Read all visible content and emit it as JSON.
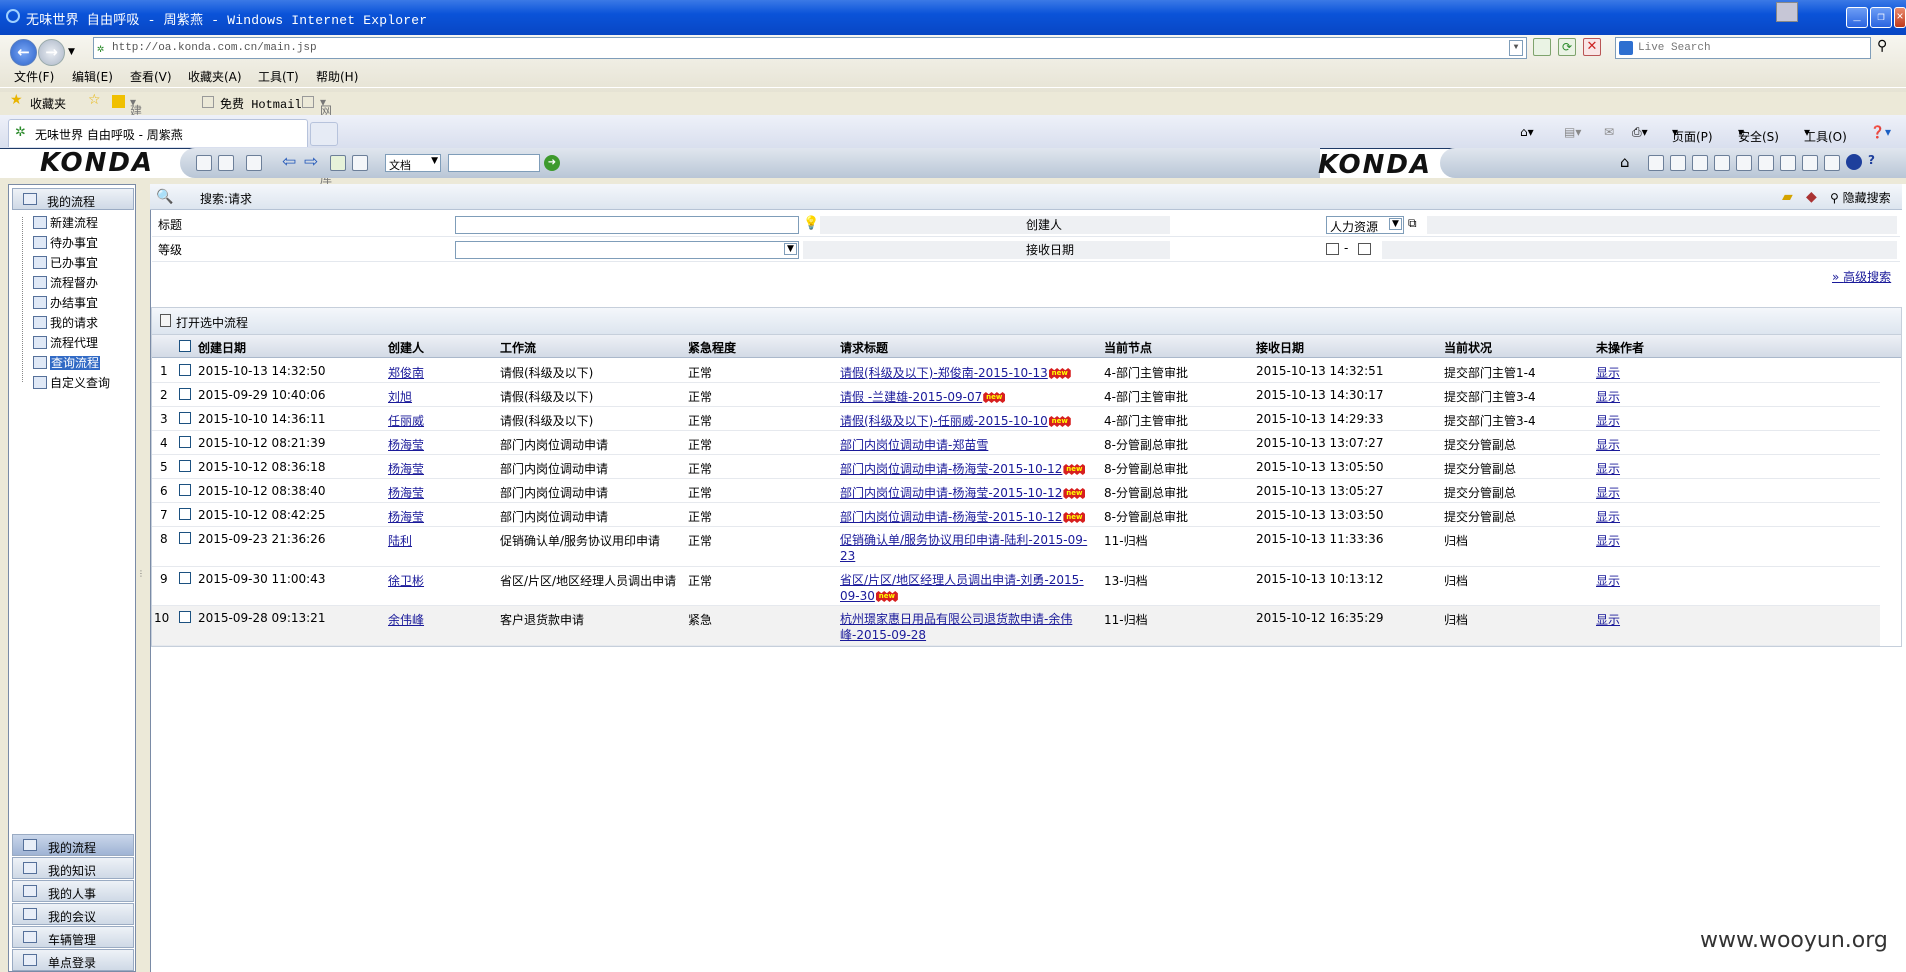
{
  "window": {
    "title": "无味世界 自由呼吸 - 周紫燕 - Windows Internet Explorer"
  },
  "address": {
    "url": "http://oa.konda.com.cn/main.jsp"
  },
  "search": {
    "placeholder": "Live Search"
  },
  "menu": [
    "文件(F)",
    "编辑(E)",
    "查看(V)",
    "收藏夹(A)",
    "工具(T)",
    "帮助(H)"
  ],
  "favbar": {
    "favorites": "收藏夹",
    "suggested": "建议网站",
    "hotmail": "免费 Hotmail",
    "webslice": "网页快讯库"
  },
  "tab": {
    "title": "无味世界 自由呼吸 - 周紫燕"
  },
  "ietools": {
    "page": "页面(P)",
    "safety": "安全(S)",
    "tools": "工具(O)"
  },
  "app": {
    "logo": "KONDA",
    "doc_select": "文档"
  },
  "left": {
    "header": "我的流程",
    "tree": [
      "新建流程",
      "待办事宜",
      "已办事宜",
      "流程督办",
      "办结事宜",
      "我的请求",
      "流程代理",
      "查询流程",
      "自定义查询"
    ],
    "selected_index": 7,
    "bottom": [
      "我的流程",
      "我的知识",
      "我的人事",
      "我的会议",
      "车辆管理",
      "单点登录"
    ]
  },
  "searchpanel": {
    "title": "搜索:请求",
    "hide_label": "隐藏搜索",
    "title_label": "标题",
    "creator_label": "创建人",
    "creator_value": "人力资源",
    "level_label": "等级",
    "date_label": "接收日期",
    "date_sep": "-",
    "advanced": "高级搜索"
  },
  "table": {
    "open_label": "打开选中流程",
    "headers": [
      "创建日期",
      "创建人",
      "工作流",
      "紧急程度",
      "请求标题",
      "当前节点",
      "接收日期",
      "当前状况",
      "未操作者"
    ],
    "rows": [
      {
        "n": "1",
        "date": "2015-10-13 14:32:50",
        "creator": "郑俊南",
        "flow": "请假(科级及以下)",
        "level": "正常",
        "title": "请假(科级及以下)-郑俊南-2015-10-13",
        "new": true,
        "node": "4-部门主管审批",
        "recv": "2015-10-13 14:32:51",
        "status": "提交部门主管1-4",
        "op": "显示"
      },
      {
        "n": "2",
        "date": "2015-09-29 10:40:06",
        "creator": "刘旭",
        "flow": "请假(科级及以下)",
        "level": "正常",
        "title": "请假 -兰建雄-2015-09-07",
        "new": true,
        "node": "4-部门主管审批",
        "recv": "2015-10-13 14:30:17",
        "status": "提交部门主管3-4",
        "op": "显示"
      },
      {
        "n": "3",
        "date": "2015-10-10 14:36:11",
        "creator": "任丽威",
        "flow": "请假(科级及以下)",
        "level": "正常",
        "title": "请假(科级及以下)-任丽威-2015-10-10",
        "new": true,
        "node": "4-部门主管审批",
        "recv": "2015-10-13 14:29:33",
        "status": "提交部门主管3-4",
        "op": "显示"
      },
      {
        "n": "4",
        "date": "2015-10-12 08:21:39",
        "creator": "杨海莹",
        "flow": "部门内岗位调动申请",
        "level": "正常",
        "title": "部门内岗位调动申请-郑苗雪",
        "new": false,
        "node": "8-分管副总审批",
        "recv": "2015-10-13 13:07:27",
        "status": "提交分管副总",
        "op": "显示"
      },
      {
        "n": "5",
        "date": "2015-10-12 08:36:18",
        "creator": "杨海莹",
        "flow": "部门内岗位调动申请",
        "level": "正常",
        "title": "部门内岗位调动申请-杨海莹-2015-10-12",
        "new": true,
        "node": "8-分管副总审批",
        "recv": "2015-10-13 13:05:50",
        "status": "提交分管副总",
        "op": "显示"
      },
      {
        "n": "6",
        "date": "2015-10-12 08:38:40",
        "creator": "杨海莹",
        "flow": "部门内岗位调动申请",
        "level": "正常",
        "title": "部门内岗位调动申请-杨海莹-2015-10-12",
        "new": true,
        "node": "8-分管副总审批",
        "recv": "2015-10-13 13:05:27",
        "status": "提交分管副总",
        "op": "显示"
      },
      {
        "n": "7",
        "date": "2015-10-12 08:42:25",
        "creator": "杨海莹",
        "flow": "部门内岗位调动申请",
        "level": "正常",
        "title": "部门内岗位调动申请-杨海莹-2015-10-12",
        "new": true,
        "node": "8-分管副总审批",
        "recv": "2015-10-13 13:03:50",
        "status": "提交分管副总",
        "op": "显示"
      },
      {
        "n": "8",
        "date": "2015-09-23 21:36:26",
        "creator": "陆利",
        "flow": "促销确认单/服务协议用印申请",
        "level": "正常",
        "title": "促销确认单/服务协议用印申请-陆利-2015-09-23",
        "new": false,
        "node": "11-归档",
        "recv": "2015-10-13 11:33:36",
        "status": "归档",
        "op": "显示"
      },
      {
        "n": "9",
        "date": "2015-09-30 11:00:43",
        "creator": "徐卫彬",
        "flow": "省区/片区/地区经理人员调出申请",
        "level": "正常",
        "title": "省区/片区/地区经理人员调出申请-刘勇-2015-09-30",
        "new": true,
        "node": "13-归档",
        "recv": "2015-10-13 10:13:12",
        "status": "归档",
        "op": "显示"
      },
      {
        "n": "10",
        "date": "2015-09-28 09:13:21",
        "creator": "余伟峰",
        "flow": "客户退货款申请",
        "level": "紧急",
        "title": "杭州璟家惠日用品有限公司退货款申请-余伟峰-2015-09-28",
        "new": false,
        "node": "11-归档",
        "recv": "2015-10-12 16:35:29",
        "status": "归档",
        "op": "显示"
      }
    ]
  },
  "new_badge": "new",
  "watermark": "www.wooyun.org"
}
